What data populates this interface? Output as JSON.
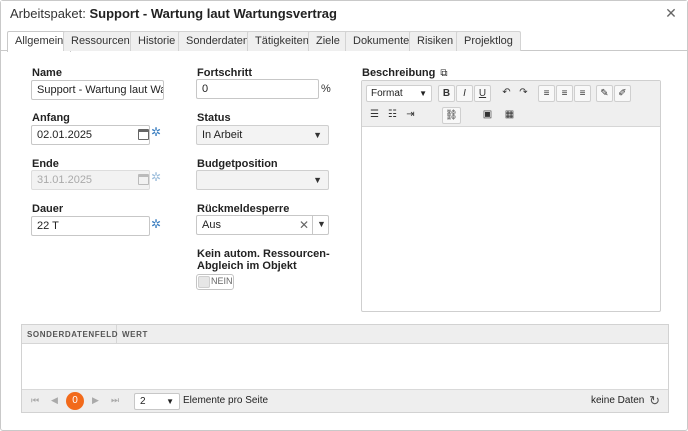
{
  "window": {
    "title_prefix": "Arbeitspaket: ",
    "title_main": "Support - Wartung laut Wartungsvertrag",
    "close_glyph": "✕"
  },
  "tabs": [
    {
      "label": "Allgemein",
      "active": true
    },
    {
      "label": "Ressourcen"
    },
    {
      "label": "Historie"
    },
    {
      "label": "Sonderdaten"
    },
    {
      "label": "Tätigkeiten"
    },
    {
      "label": "Ziele"
    },
    {
      "label": "Dokumente"
    },
    {
      "label": "Risiken"
    },
    {
      "label": "Projektlog"
    }
  ],
  "form": {
    "name": {
      "label": "Name",
      "value": "Support - Wartung laut Wart..."
    },
    "start": {
      "label": "Anfang",
      "value": "02.01.2025"
    },
    "end": {
      "label": "Ende",
      "value": "31.01.2025"
    },
    "duration": {
      "label": "Dauer",
      "value": "22 T"
    },
    "progress": {
      "label": "Fortschritt",
      "value": "0",
      "unit": "%"
    },
    "status": {
      "label": "Status",
      "value": "In Arbeit"
    },
    "budget": {
      "label": "Budgetposition",
      "value": ""
    },
    "feedback_lock": {
      "label": "Rückmeldesperre",
      "value": "Aus"
    },
    "no_resource_balance": {
      "label_line1": "Kein autom. Ressourcen-",
      "label_line2": "Abgleich im Objekt",
      "toggle_text": "NEIN"
    },
    "description": {
      "label": "Beschreibung",
      "format_label": "Format"
    }
  },
  "editor_toolbar": {
    "row1": [
      "B",
      "I",
      "U"
    ],
    "row1_icons": [
      "undo-icon",
      "redo-icon",
      "align-left-icon",
      "align-center-icon",
      "align-right-icon",
      "paint-brush-icon",
      "eraser-icon"
    ],
    "row2_icons": [
      "bulleted-list-icon",
      "numbered-list-icon",
      "indent-icon",
      "link-icon",
      "image-icon",
      "table-icon"
    ]
  },
  "grid": {
    "columns": [
      "SONDERDATENFELD",
      "WERT"
    ],
    "pager": {
      "current_page": "0",
      "page_size": "2",
      "per_page_label": "Elemente pro Seite",
      "status": "keine Daten"
    }
  }
}
